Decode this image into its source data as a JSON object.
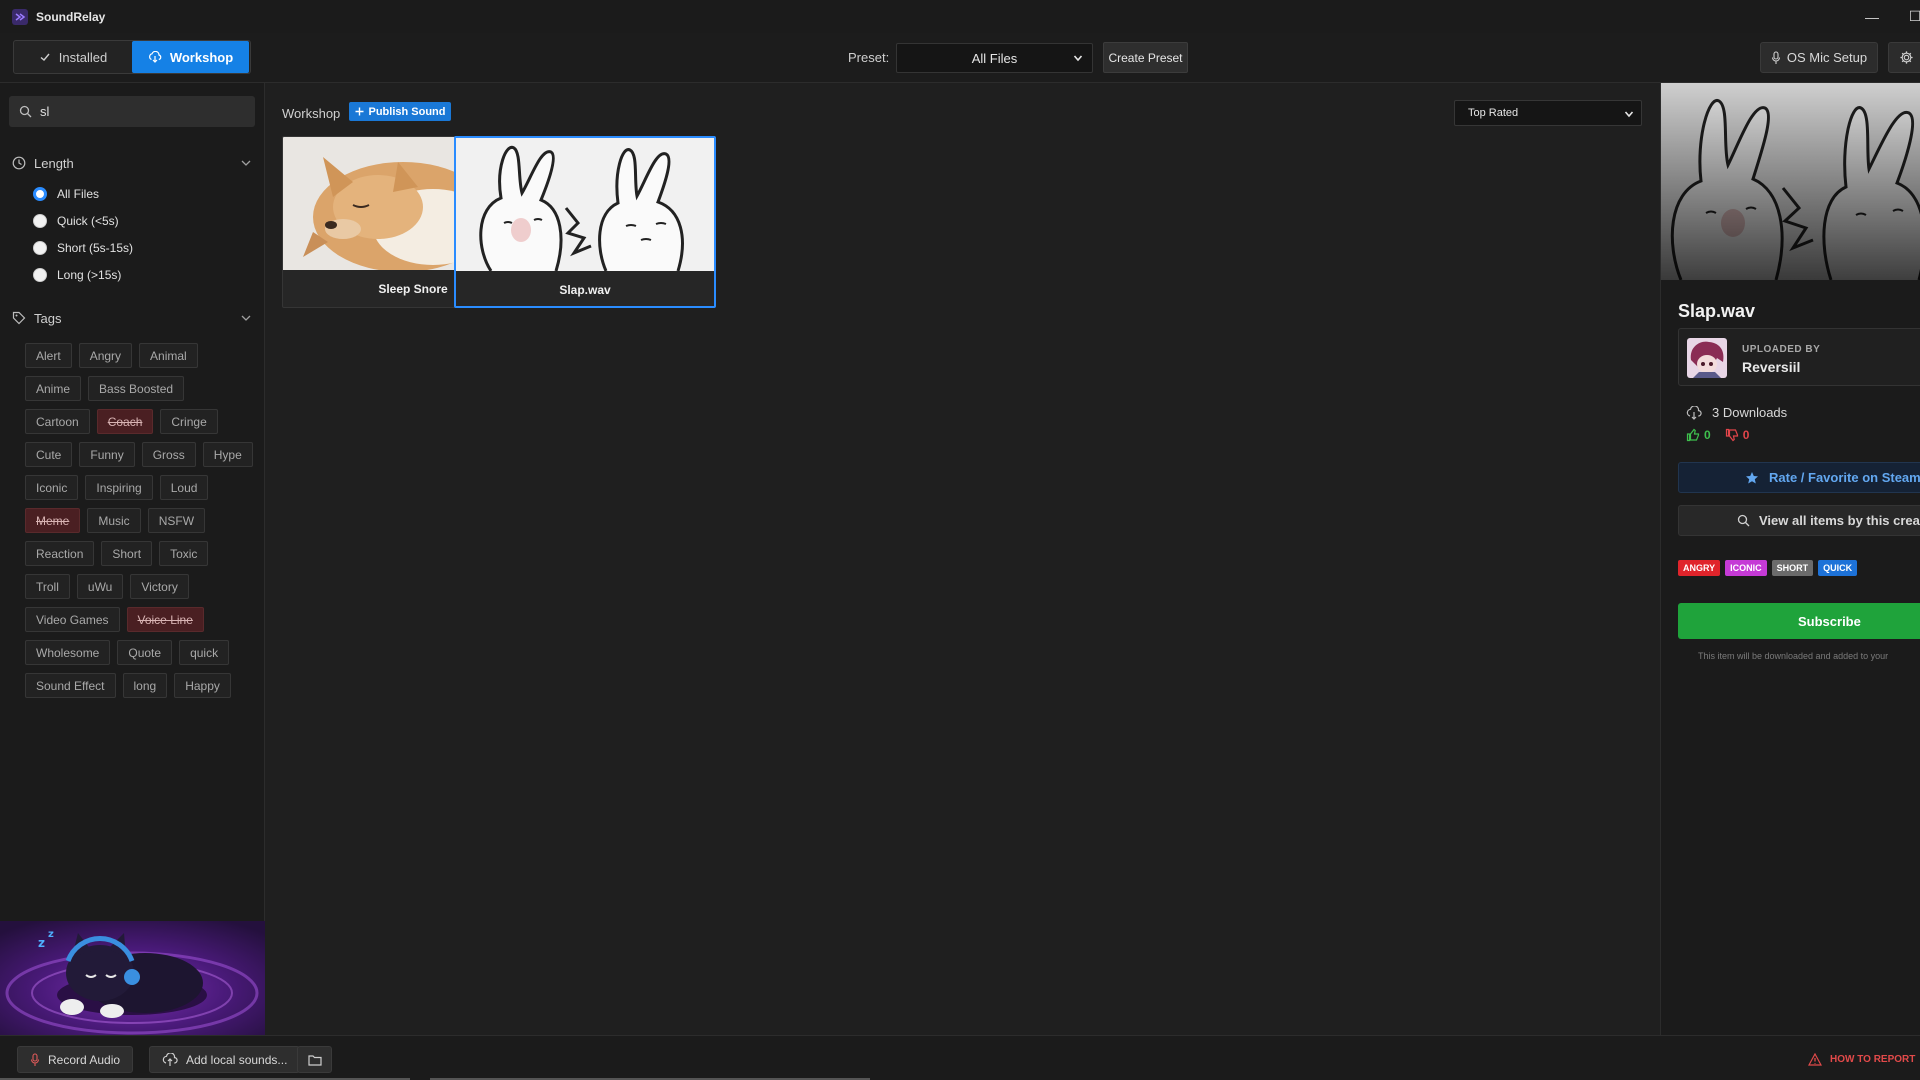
{
  "window": {
    "title": "SoundRelay",
    "minimize": "—",
    "maximize": "☐"
  },
  "toolbar": {
    "tab_installed": "Installed",
    "tab_workshop": "Workshop",
    "preset_label": "Preset:",
    "preset_value": "All Files",
    "create_preset": "Create Preset",
    "os_mic_setup": "OS Mic Setup"
  },
  "sidebar": {
    "search_value": "sl",
    "length_heading": "Length",
    "length_options": [
      "All Files",
      "Quick (<5s)",
      "Short (5s-15s)",
      "Long (>15s)"
    ],
    "length_selected": "All Files",
    "tags_heading": "Tags",
    "tags": [
      [
        "Alert",
        "Angry",
        "Animal"
      ],
      [
        "Anime",
        "Bass Boosted"
      ],
      [
        "Cartoon",
        "Coach",
        "Cringe"
      ],
      [
        "Cute",
        "Funny",
        "Gross",
        "Hype"
      ],
      [
        "Iconic",
        "Inspiring",
        "Loud"
      ],
      [
        "Meme",
        "Music",
        "NSFW"
      ],
      [
        "Reaction",
        "Short",
        "Toxic"
      ],
      [
        "Troll",
        "uWu",
        "Victory"
      ],
      [
        "Video Games",
        "Voice Line"
      ],
      [
        "Wholesome",
        "Quote",
        "quick"
      ],
      [
        "Sound Effect",
        "long",
        "Happy"
      ]
    ],
    "excluded_tags": [
      "Coach",
      "Meme",
      "Voice Line"
    ]
  },
  "main": {
    "breadcrumb": "Workshop",
    "publish_button": "Publish Sound",
    "sort_value": "Top Rated",
    "items": [
      {
        "name": "Sleep Snore",
        "selected": false
      },
      {
        "name": "Slap.wav",
        "selected": true
      }
    ]
  },
  "details": {
    "title": "Slap.wav",
    "uploaded_by_label": "UPLOADED BY",
    "uploader": "Reversiil",
    "downloads": "3 Downloads",
    "upvotes": "0",
    "downvotes": "0",
    "rate_button": "Rate / Favorite on Steam",
    "view_all_button": "View all items by this creator",
    "tags": [
      {
        "label": "ANGRY",
        "color": "#e0242b"
      },
      {
        "label": "ICONIC",
        "color": "#c53ad6"
      },
      {
        "label": "SHORT",
        "color": "#6b6b6b"
      },
      {
        "label": "QUICK",
        "color": "#1d72d8"
      }
    ],
    "subscribe_button": "Subscribe",
    "note": "This item will be downloaded and added to your"
  },
  "bottombar": {
    "record_audio": "Record Audio",
    "add_local": "Add local sounds...",
    "how_to_report": "HOW TO REPORT"
  },
  "colors": {
    "accent": "#1581e6",
    "success": "#1fa33b",
    "danger": "#e24a4a"
  }
}
